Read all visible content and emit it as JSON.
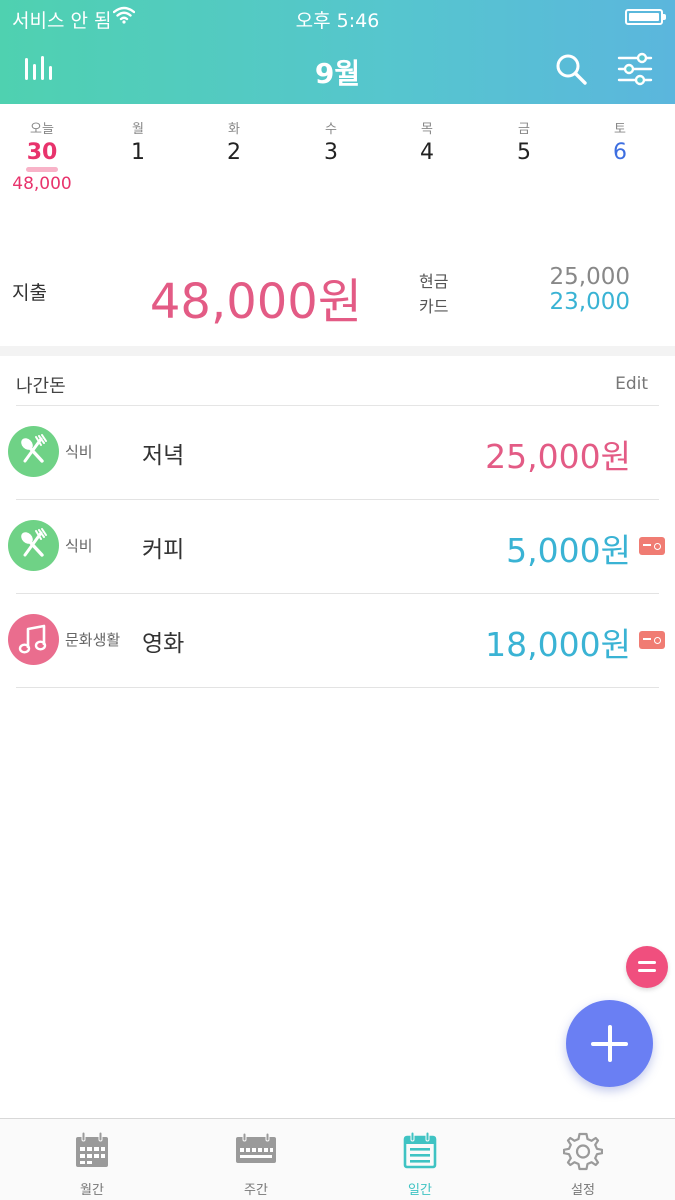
{
  "status_bar": {
    "carrier": "서비스 안 됨",
    "time": "오후 5:46"
  },
  "nav": {
    "month_title": "9월",
    "left_icon": "stats-bars-icon",
    "right_icons": [
      "search-icon",
      "filter-sliders-icon"
    ]
  },
  "week": {
    "days": [
      {
        "dow": "오늘",
        "date": "30",
        "amount": "48,000",
        "today": true
      },
      {
        "dow": "월",
        "date": "1"
      },
      {
        "dow": "화",
        "date": "2"
      },
      {
        "dow": "수",
        "date": "3"
      },
      {
        "dow": "목",
        "date": "4"
      },
      {
        "dow": "금",
        "date": "5"
      },
      {
        "dow": "토",
        "date": "6"
      }
    ]
  },
  "summary": {
    "label": "지출",
    "total": "48,000원",
    "cash_label": "현금",
    "cash_amount": "25,000",
    "card_label": "카드",
    "card_amount": "23,000"
  },
  "list": {
    "title": "나간돈",
    "edit_label": "Edit",
    "items": [
      {
        "category": "식비",
        "name": "저녁",
        "amount": "25,000원",
        "method": "cash",
        "icon": "fork-spoon-icon"
      },
      {
        "category": "식비",
        "name": "커피",
        "amount": "5,000원",
        "method": "card",
        "icon": "fork-spoon-icon"
      },
      {
        "category": "문화생활",
        "name": "영화",
        "amount": "18,000원",
        "method": "card",
        "icon": "music-note-icon"
      }
    ]
  },
  "tabs": [
    {
      "label": "월간",
      "icon": "calendar-month-icon",
      "active": false
    },
    {
      "label": "주간",
      "icon": "calendar-week-icon",
      "active": false
    },
    {
      "label": "일간",
      "icon": "calendar-day-icon",
      "active": true
    },
    {
      "label": "설정",
      "icon": "gear-icon",
      "active": false
    }
  ],
  "colors": {
    "header_gradient_start": "#4fd1b0",
    "header_gradient_end": "#5bb6dd",
    "expense_pink": "#e35b85",
    "card_blue": "#3ab3d4",
    "food_green": "#6fd286",
    "culture_pink": "#ea6d8e",
    "fab_blue": "#6a7ff3",
    "fab_pink": "#f04f7e"
  }
}
